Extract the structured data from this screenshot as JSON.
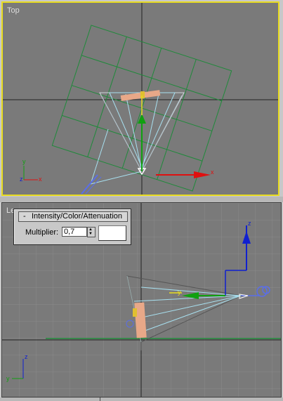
{
  "viewports": {
    "top": {
      "label": "Top"
    },
    "bottom": {
      "label": "Le"
    }
  },
  "axes": {
    "top_gizmo": {
      "x": "x",
      "y": "y"
    },
    "top_corner": {
      "x": "x",
      "y": "y",
      "z": "z"
    },
    "bottom_gizmo": {
      "y": "y",
      "z": "z"
    },
    "bottom_corner": {
      "y": "y",
      "z": "z"
    }
  },
  "rollout": {
    "collapse_symbol": "-",
    "title": "Intensity/Color/Attenuation",
    "multiplier_label": "Multiplier:",
    "multiplier_value": "0,7",
    "color_swatch": "#ffffff"
  },
  "colors": {
    "active_viewport_border": "#e8dc20",
    "viewport_bg": "#7a7a7a",
    "grid_object": "#1f8a3a",
    "light_cone": "#a8e0f0",
    "axis_x": "#e01010",
    "axis_y": "#10a010",
    "axis_z": "#1020d0"
  }
}
